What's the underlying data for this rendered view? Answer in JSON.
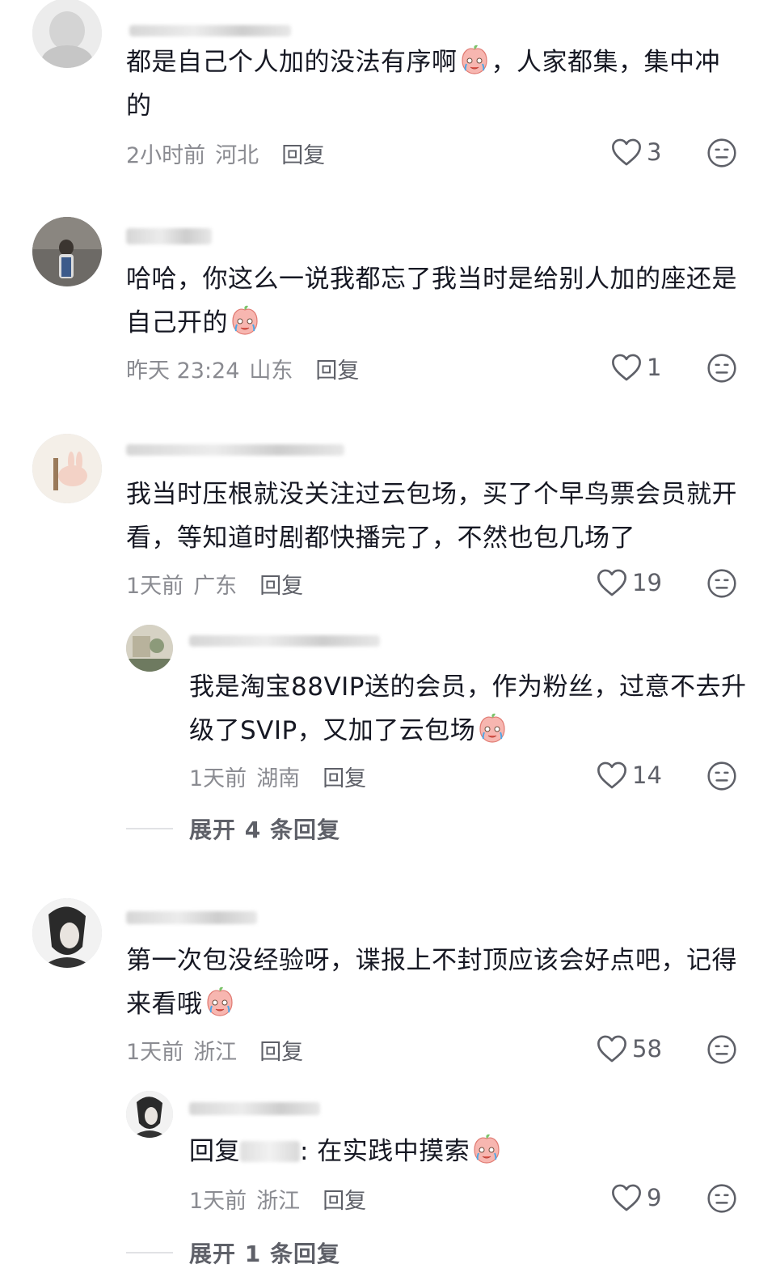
{
  "comments": [
    {
      "username": "",
      "text": "都是自己个人加的没法有序啊",
      "text_after_emoji": "，人家都集，集中冲的",
      "emoji": "peach-dizzy-emoji",
      "time": "2小时前",
      "location": "河北",
      "reply_label": "回复",
      "likes": "3"
    },
    {
      "username": "",
      "text": "哈哈，你这么一说我都忘了我当时是给别人加的座还是自己开的",
      "emoji": "peach-crying-emoji",
      "time": "昨天 23:24",
      "location": "山东",
      "reply_label": "回复",
      "likes": "1"
    },
    {
      "username": "",
      "text": "我当时压根就没关注过云包场，买了个早鸟票会员就开看，等知道时剧都快播完了，不然也包几场了",
      "time": "1天前",
      "location": "广东",
      "reply_label": "回复",
      "likes": "19",
      "sub_reply": {
        "username": "",
        "text": "我是淘宝88VIP送的会员，作为粉丝，过意不去升级了SVIP，又加了云包场",
        "emoji": "peach-crying-emoji",
        "time": "1天前",
        "location": "湖南",
        "reply_label": "回复",
        "likes": "14"
      },
      "expand_label": "展开 4 条回复"
    },
    {
      "username": "",
      "text": "第一次包没经验呀，谍报上不封顶应该会好点吧，记得来看哦",
      "emoji": "peach-eating-emoji",
      "time": "1天前",
      "location": "浙江",
      "reply_label": "回复",
      "likes": "58",
      "sub_reply": {
        "username": "",
        "text_prefix": "回复",
        "text_after": ": 在实践中摸索",
        "emoji": "peach-crying-emoji",
        "time": "1天前",
        "location": "浙江",
        "reply_label": "回复",
        "likes": "9"
      },
      "expand_label": "展开 1 条回复"
    }
  ],
  "colors": {
    "text": "#161823",
    "meta": "#8a8b91",
    "icon": "#5e6068"
  }
}
